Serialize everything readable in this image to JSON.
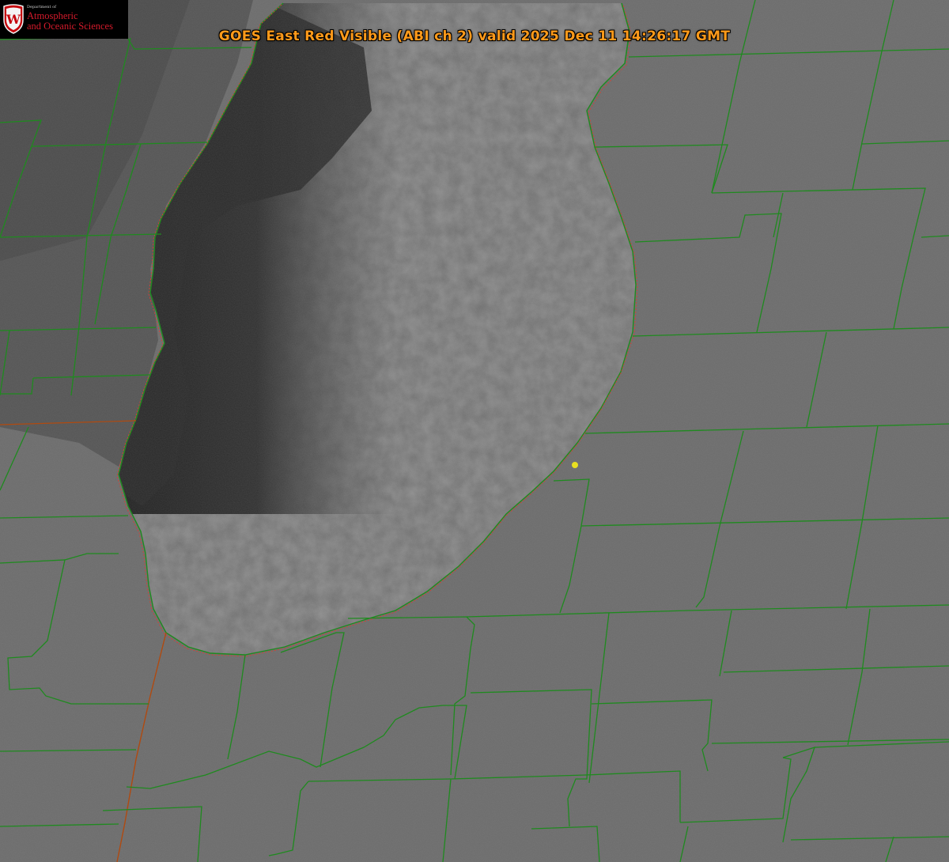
{
  "header": {
    "title": "GOES East Red Visible (ABI ch 2) valid 2025 Dec 11 14:26:17 GMT"
  },
  "logo": {
    "department": "Department of",
    "line1": "Atmospheric",
    "line2": "and Oceanic Sciences",
    "crest_letter": "W"
  },
  "colors": {
    "county_lines": "#1f8a1f",
    "state_line": "#b04a10",
    "shoreline_dash": "#d84030",
    "title_text": "#ff9a1a",
    "logo_red": "#d51a2b",
    "marker": "#e8e020",
    "lake_dark": "#2b2b2b",
    "land_gray": "#6c6c6c"
  }
}
